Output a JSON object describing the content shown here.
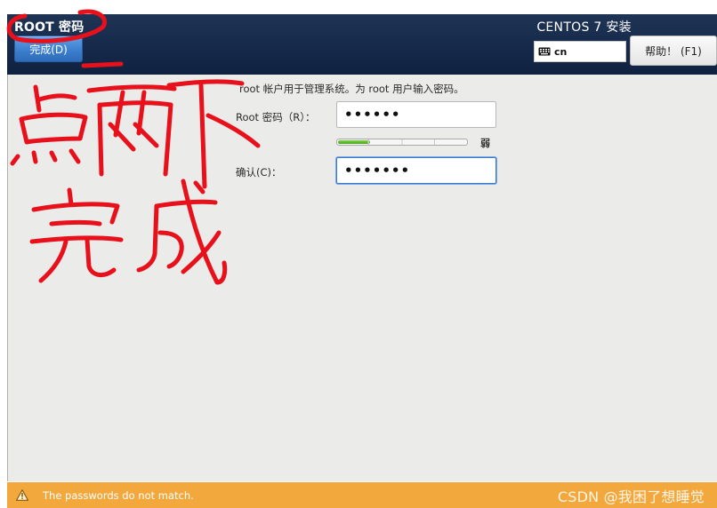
{
  "header": {
    "page_title": "ROOT 密码",
    "done_button_label": "完成(D)",
    "install_title": "CENTOS 7 安装",
    "keyboard_layout": "cn",
    "help_button_label": "帮助！ (F1)"
  },
  "form": {
    "instruction": "root 帐户用于管理系统。为 root 用户输入密码。",
    "root_password_label": "Root 密码（R）：",
    "root_password_value": "••••••",
    "strength_level": 0.25,
    "strength_label": "弱",
    "confirm_label": "确认(C)：",
    "confirm_value": "•••••••"
  },
  "status_bar": {
    "message": "The passwords do not match.",
    "watermark": "CSDN @我困了想睡觉"
  },
  "handwritten_annotation": "点两下 完成",
  "colors": {
    "header_bg": "#16294a",
    "done_button": "#3a7dcc",
    "content_bg": "#ebebea",
    "status_bar": "#f2a83c",
    "annotation_ink": "#e8101a",
    "strength_fill": "#4aa520",
    "focus_ring": "#3b7bd1"
  },
  "icons": {
    "keyboard": "keyboard-icon",
    "warning": "warning-icon"
  }
}
